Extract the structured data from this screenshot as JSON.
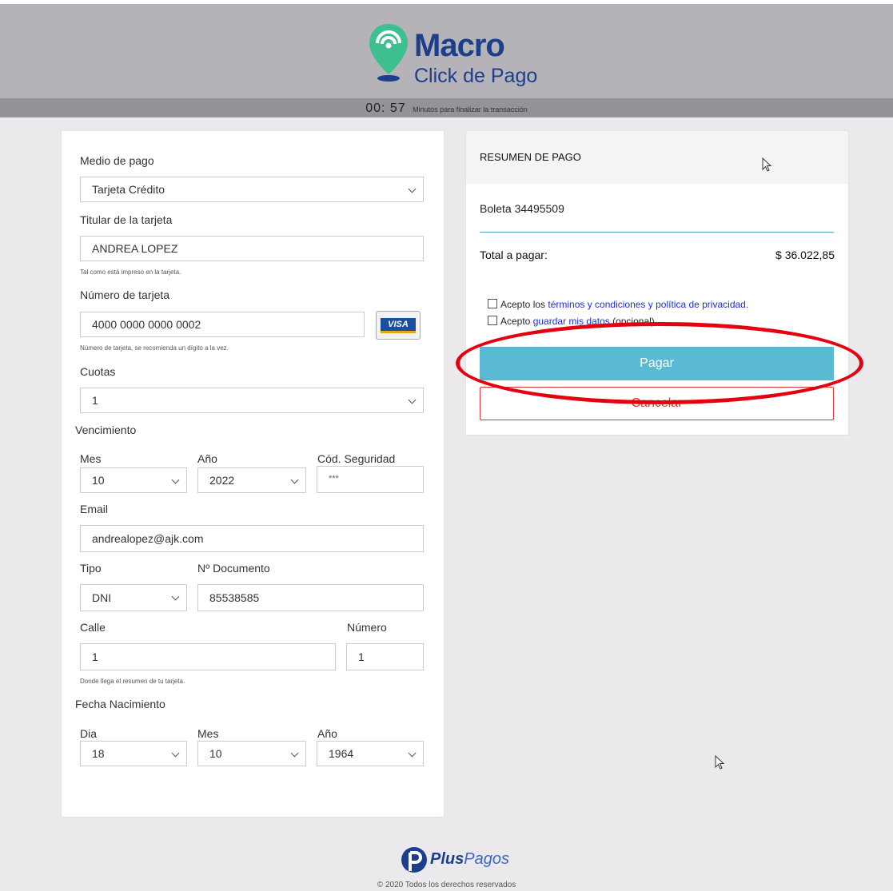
{
  "brand": {
    "name": "Macro",
    "subtitle": "Click de Pago",
    "accent": "#1c3f8c",
    "pin_color": "#3dbf8f"
  },
  "timer": {
    "value": "00: 57",
    "label": "Minutos para finalizar la transacción"
  },
  "form": {
    "medio_pago": {
      "label": "Medio de pago",
      "value": "Tarjeta Crédito"
    },
    "titular": {
      "label": "Titular de la tarjeta",
      "value": "ANDREA LOPEZ",
      "hint": "Tal como está impreso en la tarjeta."
    },
    "numero": {
      "label": "Número de tarjeta",
      "value": "4000 0000 0000 0002",
      "hint": "Número de tarjeta, se recomienda un dígito a la vez.",
      "card_brand": "VISA"
    },
    "cuotas": {
      "label": "Cuotas",
      "value": "1"
    },
    "vencimiento": {
      "label": "Vencimiento",
      "mes_label": "Mes",
      "mes": "10",
      "anio_label": "Año",
      "anio": "2022",
      "cod_label": "Cód. Seguridad",
      "cod": "***"
    },
    "email": {
      "label": "Email",
      "value": "andrealopez@ajk.com"
    },
    "tipo": {
      "label": "Tipo",
      "value": "DNI"
    },
    "documento": {
      "label": "Nº Documento",
      "value": "85538585"
    },
    "calle": {
      "label": "Calle",
      "value": "1",
      "hint": "Donde llega el resumen de tu tarjeta."
    },
    "numero_calle": {
      "label": "Número",
      "value": "1"
    },
    "nacimiento": {
      "label": "Fecha Nacimiento",
      "dia_label": "Dia",
      "dia": "18",
      "mes_label": "Mes",
      "mes": "10",
      "anio_label": "Año",
      "anio": "1964"
    }
  },
  "summary": {
    "title": "RESUMEN DE PAGO",
    "item": "Boleta 34495509",
    "total_label": "Total a pagar:",
    "total_value": "$ 36.022,85",
    "terms_prefix": "Acepto los ",
    "terms_link": "términos y condiciones y política de privacidad.",
    "save_prefix": "Acepto ",
    "save_link": "guardar mis datos",
    "save_suffix": " (opcional)",
    "pay_label": "Pagar",
    "cancel_label": "Cancelar",
    "pay_color": "#5bbad3",
    "cancel_color": "#dd3333"
  },
  "annotation": {
    "highlight_color": "#e4000f"
  },
  "footer": {
    "brand_bold": "Plus",
    "brand_rest": "Pagos",
    "copyright": "© 2020 Todos los derechos reservados"
  }
}
